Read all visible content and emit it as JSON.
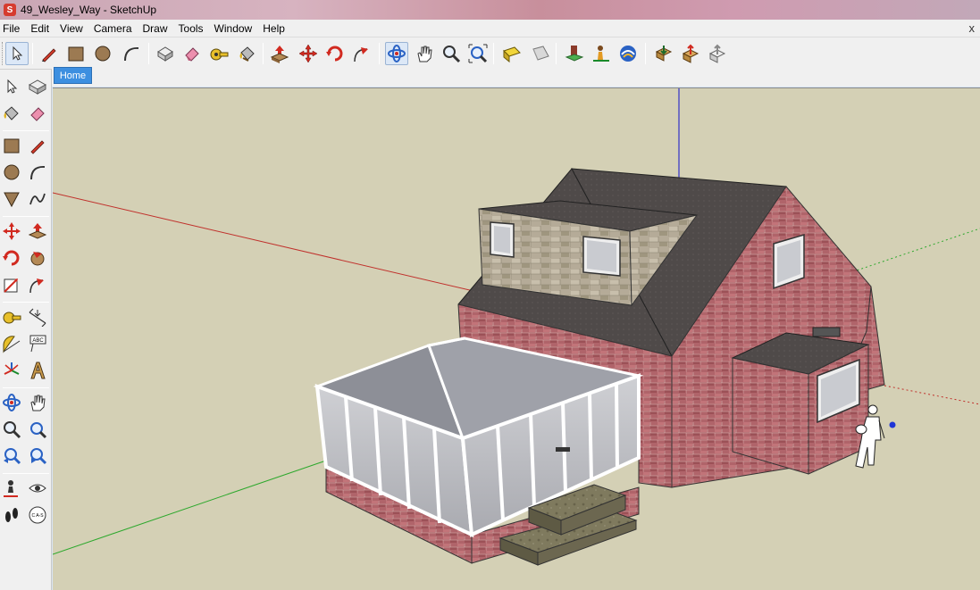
{
  "window": {
    "title": "49_Wesley_Way - SketchUp",
    "app_icon_letter": "S"
  },
  "menubar": {
    "items": [
      "File",
      "Edit",
      "View",
      "Camera",
      "Draw",
      "Tools",
      "Window",
      "Help"
    ],
    "close_glyph": "x"
  },
  "toolbar": {
    "items": [
      "select-icon",
      "pencil-icon",
      "rectangle-icon",
      "circle-icon",
      "arc-icon",
      "make-component-icon",
      "eraser-icon",
      "tape-measure-icon",
      "paint-bucket-icon",
      "push-pull-icon",
      "move-icon",
      "rotate-icon",
      "follow-me-icon",
      "orbit-icon",
      "pan-icon",
      "zoom-icon",
      "zoom-extents-icon",
      "section-plane-icon",
      "walk-icon",
      "sandbox-icon",
      "position-camera-icon",
      "photo-textures-icon",
      "get-models-icon",
      "share-model-icon",
      "share-component-icon"
    ]
  },
  "scene_tabs": [
    {
      "label": "Home"
    }
  ],
  "left_toolbar": {
    "rows": [
      [
        "select-icon",
        "make-component-icon"
      ],
      [
        "paint-bucket-icon",
        "eraser-icon"
      ],
      [
        "rectangle-icon",
        "pencil-icon"
      ],
      [
        "circle-icon",
        "arc-icon"
      ],
      [
        "polygon-icon",
        "freehand-icon"
      ],
      [
        "move-icon",
        "push-pull-icon"
      ],
      [
        "rotate-icon",
        "follow-me-icon"
      ],
      [
        "scale-icon",
        "offset-icon"
      ],
      [
        "tape-measure-icon",
        "dimension-icon"
      ],
      [
        "protractor-icon",
        "text-icon"
      ],
      [
        "axes-icon",
        "3d-text-icon"
      ],
      [
        "orbit-icon",
        "pan-icon"
      ],
      [
        "zoom-icon",
        "zoom-window-icon"
      ],
      [
        "previous-view-icon",
        "next-view-icon"
      ],
      [
        "position-camera-icon",
        "look-around-icon"
      ],
      [
        "walk-icon",
        "section-plane-icon"
      ]
    ],
    "text_tool_glyph": "ABC",
    "section_tool_glyph": "C A-S"
  },
  "viewport": {
    "background": "#d4d0b5",
    "axis_colors": {
      "red": "#c0312c",
      "green": "#2da82d",
      "blue": "#3030c8"
    },
    "model_description": "brick house with dormer, conservatory and steps",
    "figure": "person-figure"
  }
}
